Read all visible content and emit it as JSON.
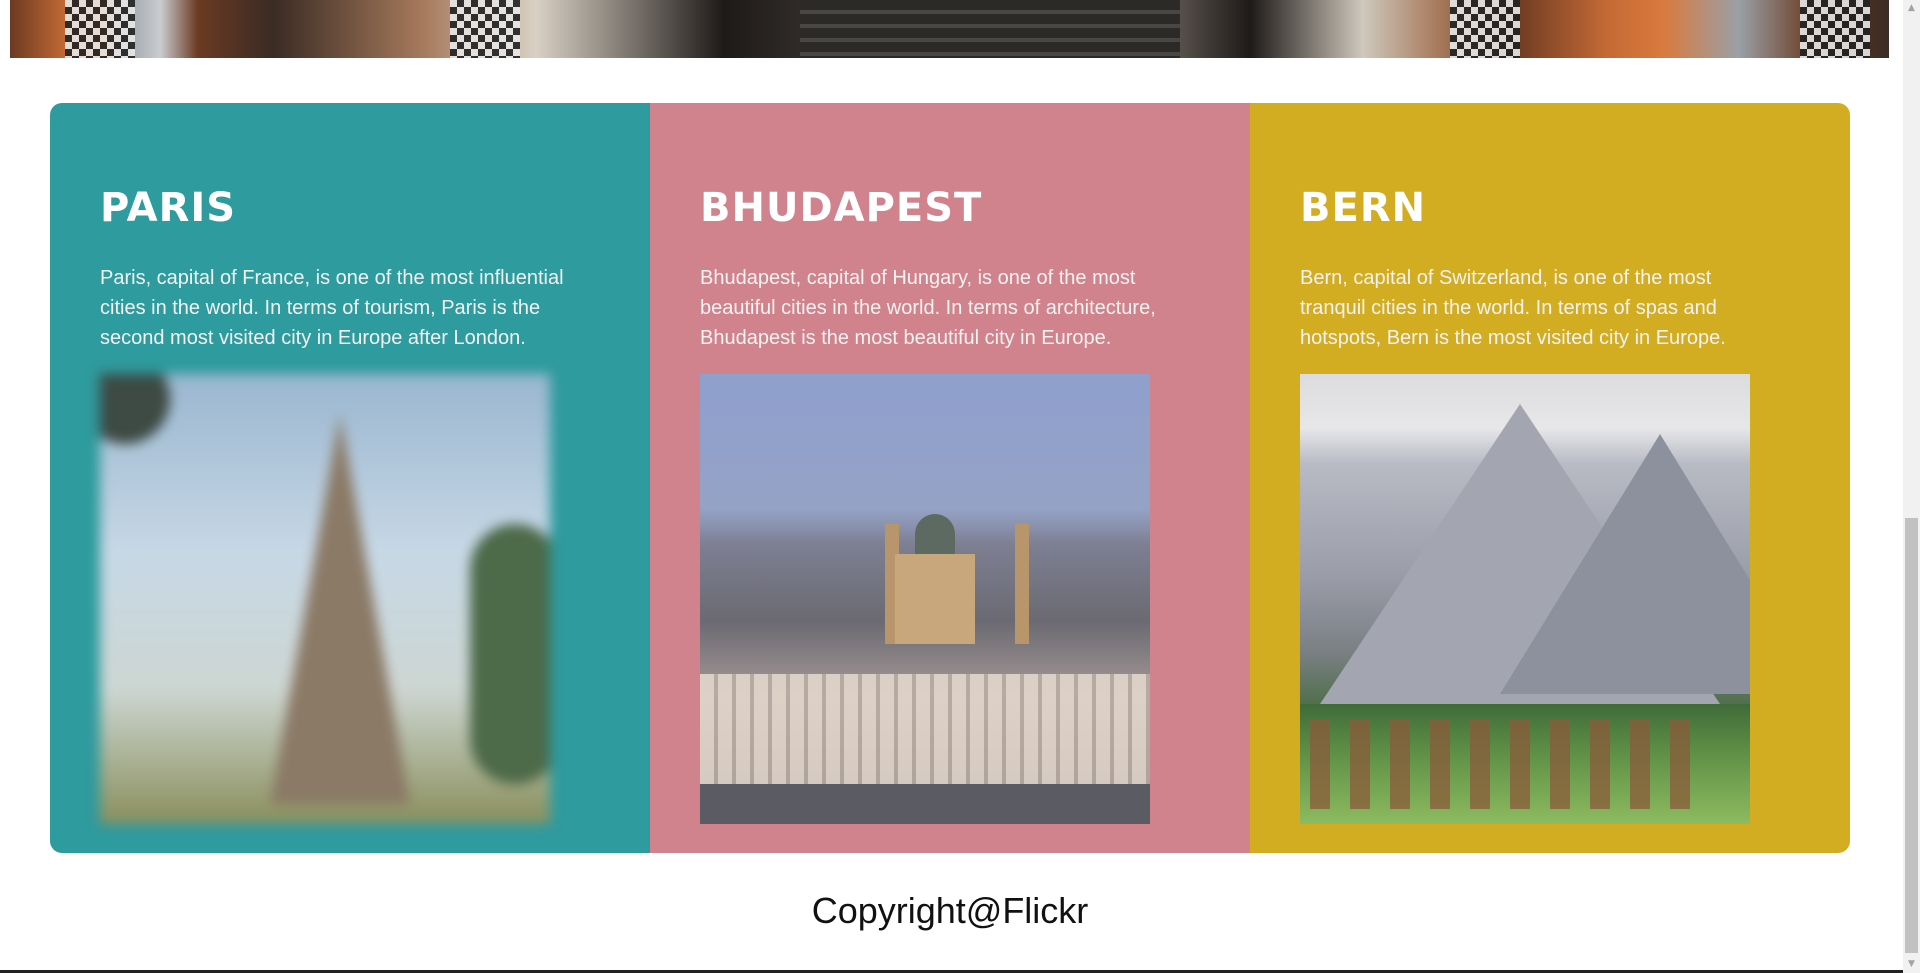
{
  "cities": [
    {
      "title": "PARIS",
      "description": "Paris, capital of France, is one of the most influential cities in the world. In terms of tourism, Paris is the second most visited city in Europe after London.",
      "color": "#2e9b9e"
    },
    {
      "title": "BHUDAPEST",
      "description": "Bhudapest, capital of Hungary, is one of the most beautiful cities in the world. In terms of architecture, Bhudapest is the most beautiful city in Europe.",
      "color": "#d0838c"
    },
    {
      "title": "BERN",
      "description": "Bern, capital of Switzerland, is one of the most tranquil cities in the world. In terms of spas and hotspots, Bern is the most visited city in Europe.",
      "color": "#d3ad21"
    }
  ],
  "footer": {
    "copyright": "Copyright@Flickr"
  }
}
